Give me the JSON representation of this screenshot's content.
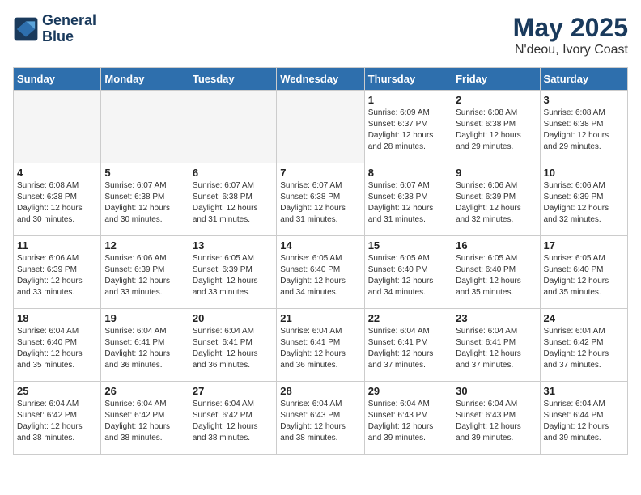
{
  "header": {
    "logo_line1": "General",
    "logo_line2": "Blue",
    "month_year": "May 2025",
    "location": "N'deou, Ivory Coast"
  },
  "weekdays": [
    "Sunday",
    "Monday",
    "Tuesday",
    "Wednesday",
    "Thursday",
    "Friday",
    "Saturday"
  ],
  "weeks": [
    [
      {
        "day": "",
        "info": "",
        "empty": true
      },
      {
        "day": "",
        "info": "",
        "empty": true
      },
      {
        "day": "",
        "info": "",
        "empty": true
      },
      {
        "day": "",
        "info": "",
        "empty": true
      },
      {
        "day": "1",
        "info": "Sunrise: 6:09 AM\nSunset: 6:37 PM\nDaylight: 12 hours\nand 28 minutes."
      },
      {
        "day": "2",
        "info": "Sunrise: 6:08 AM\nSunset: 6:38 PM\nDaylight: 12 hours\nand 29 minutes."
      },
      {
        "day": "3",
        "info": "Sunrise: 6:08 AM\nSunset: 6:38 PM\nDaylight: 12 hours\nand 29 minutes."
      }
    ],
    [
      {
        "day": "4",
        "info": "Sunrise: 6:08 AM\nSunset: 6:38 PM\nDaylight: 12 hours\nand 30 minutes."
      },
      {
        "day": "5",
        "info": "Sunrise: 6:07 AM\nSunset: 6:38 PM\nDaylight: 12 hours\nand 30 minutes."
      },
      {
        "day": "6",
        "info": "Sunrise: 6:07 AM\nSunset: 6:38 PM\nDaylight: 12 hours\nand 31 minutes."
      },
      {
        "day": "7",
        "info": "Sunrise: 6:07 AM\nSunset: 6:38 PM\nDaylight: 12 hours\nand 31 minutes."
      },
      {
        "day": "8",
        "info": "Sunrise: 6:07 AM\nSunset: 6:38 PM\nDaylight: 12 hours\nand 31 minutes."
      },
      {
        "day": "9",
        "info": "Sunrise: 6:06 AM\nSunset: 6:39 PM\nDaylight: 12 hours\nand 32 minutes."
      },
      {
        "day": "10",
        "info": "Sunrise: 6:06 AM\nSunset: 6:39 PM\nDaylight: 12 hours\nand 32 minutes."
      }
    ],
    [
      {
        "day": "11",
        "info": "Sunrise: 6:06 AM\nSunset: 6:39 PM\nDaylight: 12 hours\nand 33 minutes."
      },
      {
        "day": "12",
        "info": "Sunrise: 6:06 AM\nSunset: 6:39 PM\nDaylight: 12 hours\nand 33 minutes."
      },
      {
        "day": "13",
        "info": "Sunrise: 6:05 AM\nSunset: 6:39 PM\nDaylight: 12 hours\nand 33 minutes."
      },
      {
        "day": "14",
        "info": "Sunrise: 6:05 AM\nSunset: 6:40 PM\nDaylight: 12 hours\nand 34 minutes."
      },
      {
        "day": "15",
        "info": "Sunrise: 6:05 AM\nSunset: 6:40 PM\nDaylight: 12 hours\nand 34 minutes."
      },
      {
        "day": "16",
        "info": "Sunrise: 6:05 AM\nSunset: 6:40 PM\nDaylight: 12 hours\nand 35 minutes."
      },
      {
        "day": "17",
        "info": "Sunrise: 6:05 AM\nSunset: 6:40 PM\nDaylight: 12 hours\nand 35 minutes."
      }
    ],
    [
      {
        "day": "18",
        "info": "Sunrise: 6:04 AM\nSunset: 6:40 PM\nDaylight: 12 hours\nand 35 minutes."
      },
      {
        "day": "19",
        "info": "Sunrise: 6:04 AM\nSunset: 6:41 PM\nDaylight: 12 hours\nand 36 minutes."
      },
      {
        "day": "20",
        "info": "Sunrise: 6:04 AM\nSunset: 6:41 PM\nDaylight: 12 hours\nand 36 minutes."
      },
      {
        "day": "21",
        "info": "Sunrise: 6:04 AM\nSunset: 6:41 PM\nDaylight: 12 hours\nand 36 minutes."
      },
      {
        "day": "22",
        "info": "Sunrise: 6:04 AM\nSunset: 6:41 PM\nDaylight: 12 hours\nand 37 minutes."
      },
      {
        "day": "23",
        "info": "Sunrise: 6:04 AM\nSunset: 6:41 PM\nDaylight: 12 hours\nand 37 minutes."
      },
      {
        "day": "24",
        "info": "Sunrise: 6:04 AM\nSunset: 6:42 PM\nDaylight: 12 hours\nand 37 minutes."
      }
    ],
    [
      {
        "day": "25",
        "info": "Sunrise: 6:04 AM\nSunset: 6:42 PM\nDaylight: 12 hours\nand 38 minutes."
      },
      {
        "day": "26",
        "info": "Sunrise: 6:04 AM\nSunset: 6:42 PM\nDaylight: 12 hours\nand 38 minutes."
      },
      {
        "day": "27",
        "info": "Sunrise: 6:04 AM\nSunset: 6:42 PM\nDaylight: 12 hours\nand 38 minutes."
      },
      {
        "day": "28",
        "info": "Sunrise: 6:04 AM\nSunset: 6:43 PM\nDaylight: 12 hours\nand 38 minutes."
      },
      {
        "day": "29",
        "info": "Sunrise: 6:04 AM\nSunset: 6:43 PM\nDaylight: 12 hours\nand 39 minutes."
      },
      {
        "day": "30",
        "info": "Sunrise: 6:04 AM\nSunset: 6:43 PM\nDaylight: 12 hours\nand 39 minutes."
      },
      {
        "day": "31",
        "info": "Sunrise: 6:04 AM\nSunset: 6:44 PM\nDaylight: 12 hours\nand 39 minutes."
      }
    ]
  ]
}
